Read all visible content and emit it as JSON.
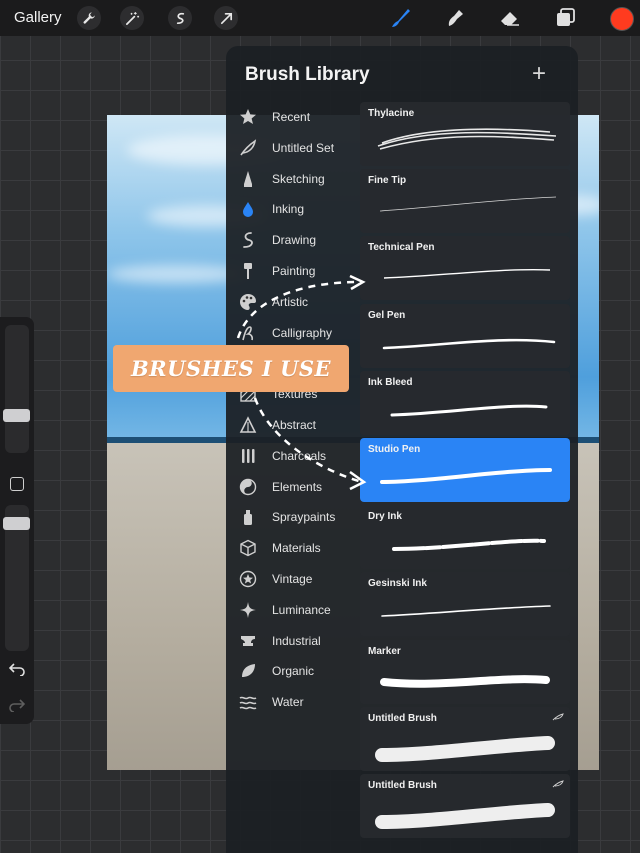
{
  "topbar": {
    "gallery_label": "Gallery",
    "left_tools": [
      "wrench-icon",
      "magic-wand-icon",
      "selection-icon",
      "transform-arrow-icon"
    ],
    "right_tools": [
      "brush-icon",
      "smudge-icon",
      "eraser-icon",
      "layers-icon"
    ],
    "current_color": "#ff3b1f"
  },
  "panel": {
    "title": "Brush Library",
    "add_icon": "plus-icon"
  },
  "categories": [
    {
      "label": "Recent",
      "icon": "star-icon"
    },
    {
      "label": "Untitled Set",
      "icon": "feather-icon"
    },
    {
      "label": "Sketching",
      "icon": "pencil-tip-icon"
    },
    {
      "label": "Inking",
      "icon": "ink-drop-icon"
    },
    {
      "label": "Drawing",
      "icon": "squiggle-icon"
    },
    {
      "label": "Painting",
      "icon": "paint-roller-icon"
    },
    {
      "label": "Artistic",
      "icon": "palette-icon"
    },
    {
      "label": "Calligraphy",
      "icon": "calligraphy-icon"
    },
    {
      "label": "",
      "icon": ""
    },
    {
      "label": "Textures",
      "icon": "texture-icon"
    },
    {
      "label": "Abstract",
      "icon": "triangle-icon"
    },
    {
      "label": "Charcoals",
      "icon": "charcoal-icon"
    },
    {
      "label": "Elements",
      "icon": "yin-yang-icon"
    },
    {
      "label": "Spraypaints",
      "icon": "spray-can-icon"
    },
    {
      "label": "Materials",
      "icon": "cube-icon"
    },
    {
      "label": "Vintage",
      "icon": "vintage-star-icon"
    },
    {
      "label": "Luminance",
      "icon": "sparkle-icon"
    },
    {
      "label": "Industrial",
      "icon": "anvil-icon"
    },
    {
      "label": "Organic",
      "icon": "leaf-icon"
    },
    {
      "label": "Water",
      "icon": "waves-icon"
    }
  ],
  "brushes": [
    {
      "name": "Thylacine",
      "selected": false
    },
    {
      "name": "Fine Tip",
      "selected": false
    },
    {
      "name": "Technical Pen",
      "selected": false
    },
    {
      "name": "Gel Pen",
      "selected": false
    },
    {
      "name": "Ink Bleed",
      "selected": false
    },
    {
      "name": "Studio Pen",
      "selected": true
    },
    {
      "name": "Dry Ink",
      "selected": false
    },
    {
      "name": "Gesinski Ink",
      "selected": false
    },
    {
      "name": "Marker",
      "selected": false
    },
    {
      "name": "Untitled Brush",
      "selected": false
    },
    {
      "name": "Untitled Brush",
      "selected": false
    }
  ],
  "overlay": {
    "banner_text": "BRUSHES I USE",
    "accent_color": "#f0a770"
  },
  "selection_color": "#2a84f5"
}
